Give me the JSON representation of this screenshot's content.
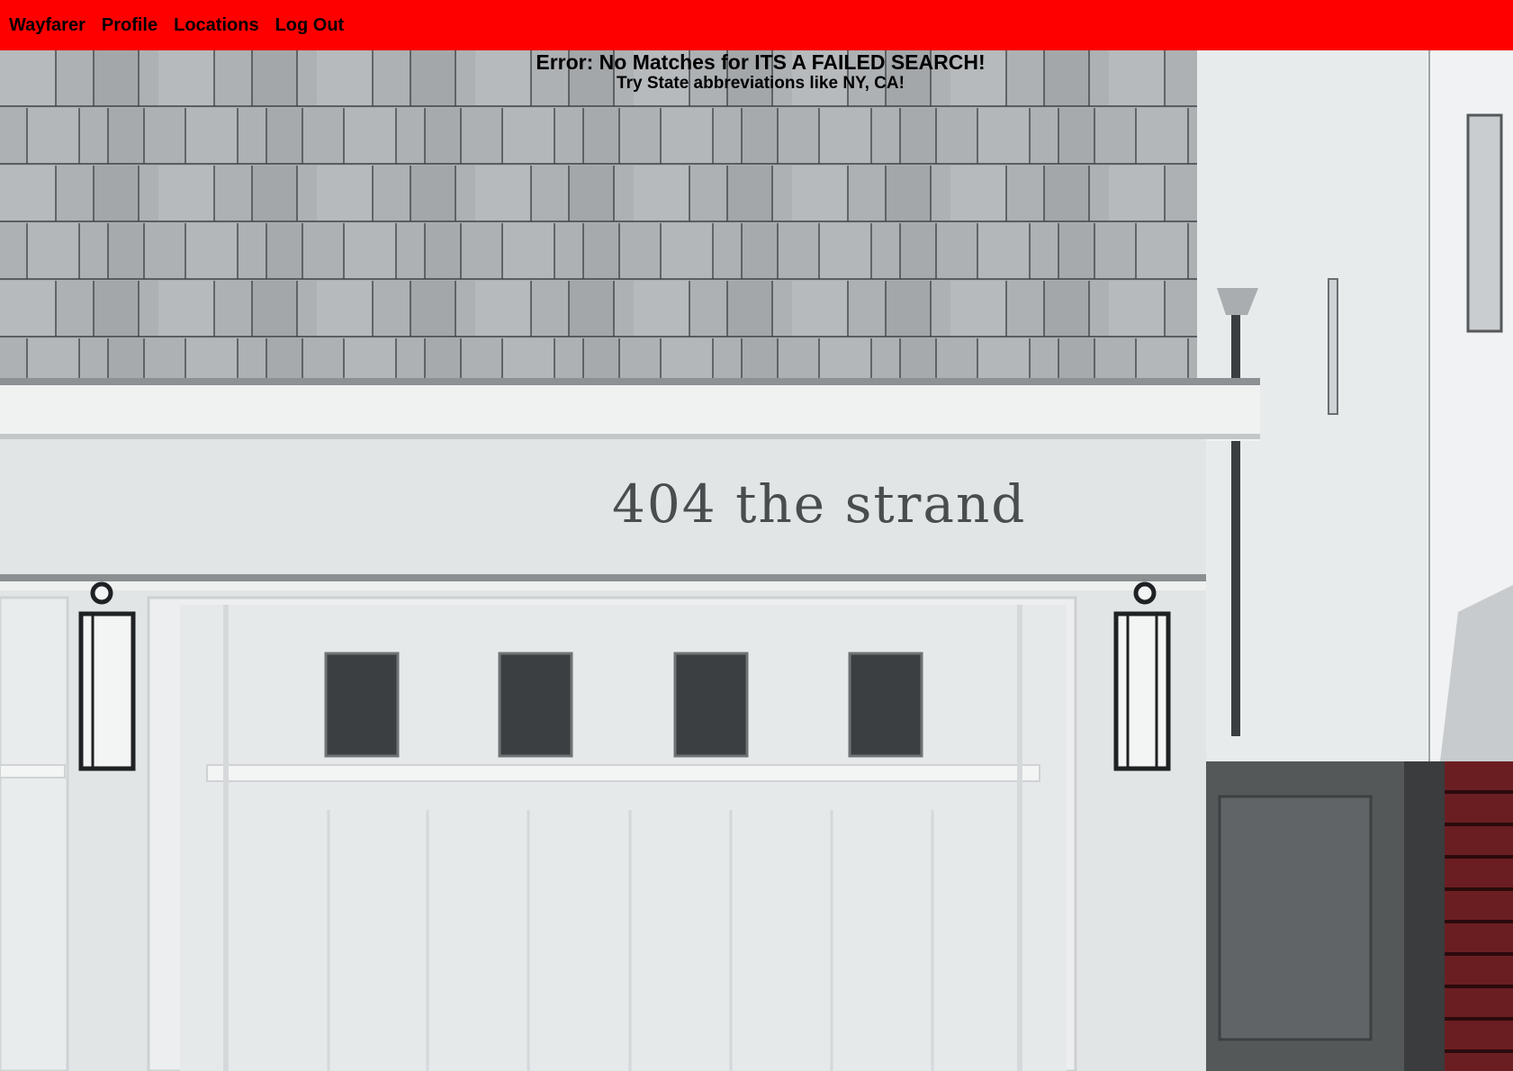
{
  "nav": {
    "items": [
      {
        "label": "Wayfarer"
      },
      {
        "label": "Profile"
      },
      {
        "label": "Locations"
      },
      {
        "label": "Log Out"
      }
    ]
  },
  "error": {
    "title": "Error: No Matches for ITS A FAILED SEARCH!",
    "hint": "Try State abbreviations like NY, CA!"
  },
  "photo": {
    "sign_text": "404 the strand"
  },
  "colors": {
    "navbar": "#ff0000",
    "shingle": "#a9adb0",
    "wall": "#e3e6e7",
    "gate": "#555555",
    "fence": "#6b1e22"
  }
}
